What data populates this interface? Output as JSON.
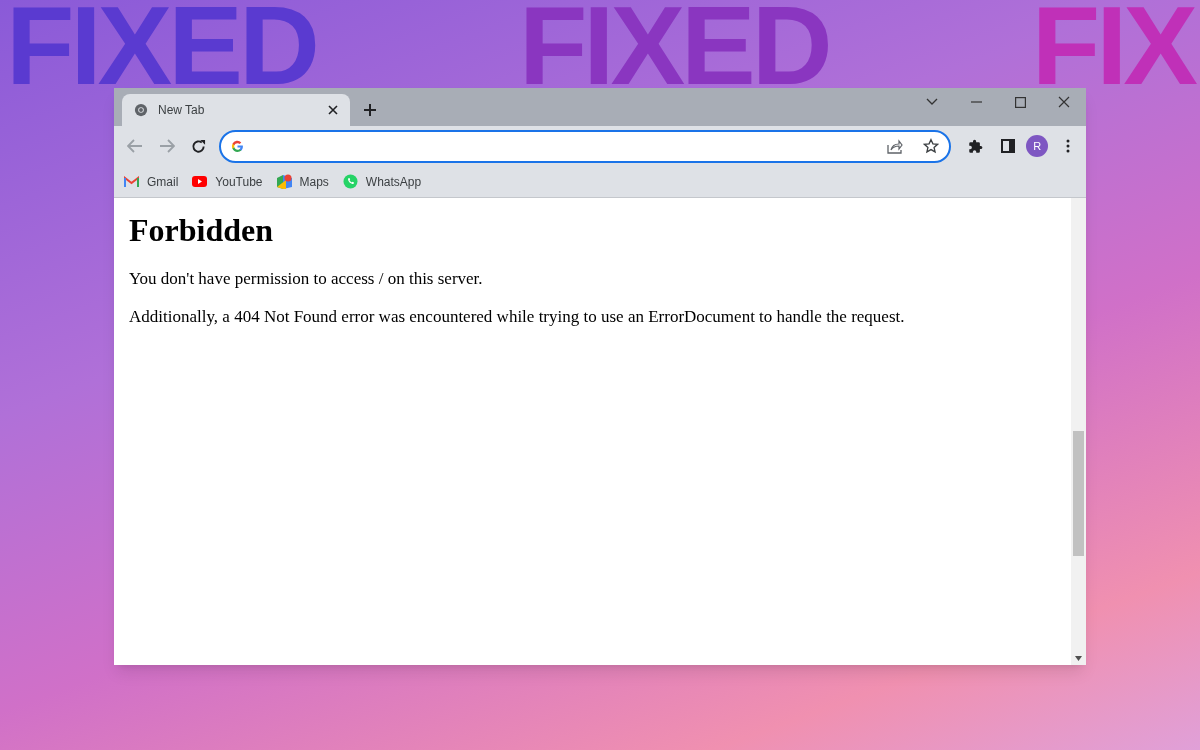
{
  "background_words": [
    "FIXED",
    "FIXED",
    "FIX"
  ],
  "window": {
    "tabs": [
      {
        "title": "New Tab",
        "selected": true
      }
    ],
    "profile_initial": "R",
    "bookmarks": [
      {
        "label": "Gmail",
        "kind": "gmail"
      },
      {
        "label": "YouTube",
        "kind": "youtube"
      },
      {
        "label": "Maps",
        "kind": "maps"
      },
      {
        "label": "WhatsApp",
        "kind": "whatsapp"
      }
    ]
  },
  "page": {
    "heading": "Forbidden",
    "paragraphs": [
      "You don't have permission to access / on this server.",
      "Additionally, a 404 Not Found error was encountered while trying to use an ErrorDocument to handle the request."
    ]
  }
}
